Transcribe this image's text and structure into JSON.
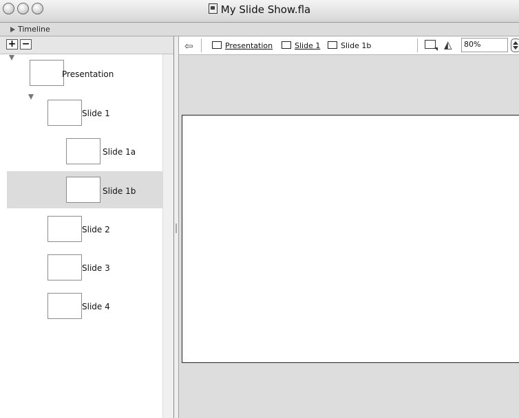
{
  "window": {
    "title": "My Slide Show.fla",
    "controls": [
      "close-button",
      "minimize-button",
      "zoom-button"
    ]
  },
  "timeline": {
    "label": "Timeline",
    "expanded": false
  },
  "slide_panel": {
    "add_label": "+",
    "remove_label": "−",
    "tree": [
      {
        "label": "Presentation",
        "level": 0,
        "expanded": true,
        "selected": false
      },
      {
        "label": "Slide 1",
        "level": 1,
        "expanded": true,
        "selected": false
      },
      {
        "label": "Slide 1a",
        "level": 2,
        "selected": false
      },
      {
        "label": "Slide 1b",
        "level": 2,
        "selected": true
      },
      {
        "label": "Slide 2",
        "level": 1,
        "selected": false
      },
      {
        "label": "Slide 3",
        "level": 1,
        "selected": false
      },
      {
        "label": "Slide 4",
        "level": 1,
        "selected": false
      }
    ]
  },
  "stage_toolbar": {
    "back_icon": "back-arrow-icon",
    "breadcrumbs": [
      {
        "label": "Presentation",
        "link": true
      },
      {
        "label": "Slide 1",
        "link": true
      },
      {
        "label": "Slide 1b",
        "link": false
      }
    ],
    "edit_scene_icon": "edit-scene-icon",
    "edit_symbols_icon": "edit-symbols-icon",
    "zoom": "80%"
  },
  "colors": {
    "selection": "#dcdcdc",
    "pasteboard": "#dddddd",
    "stage": "#ffffff",
    "titlebar": "#e0e0e0"
  }
}
